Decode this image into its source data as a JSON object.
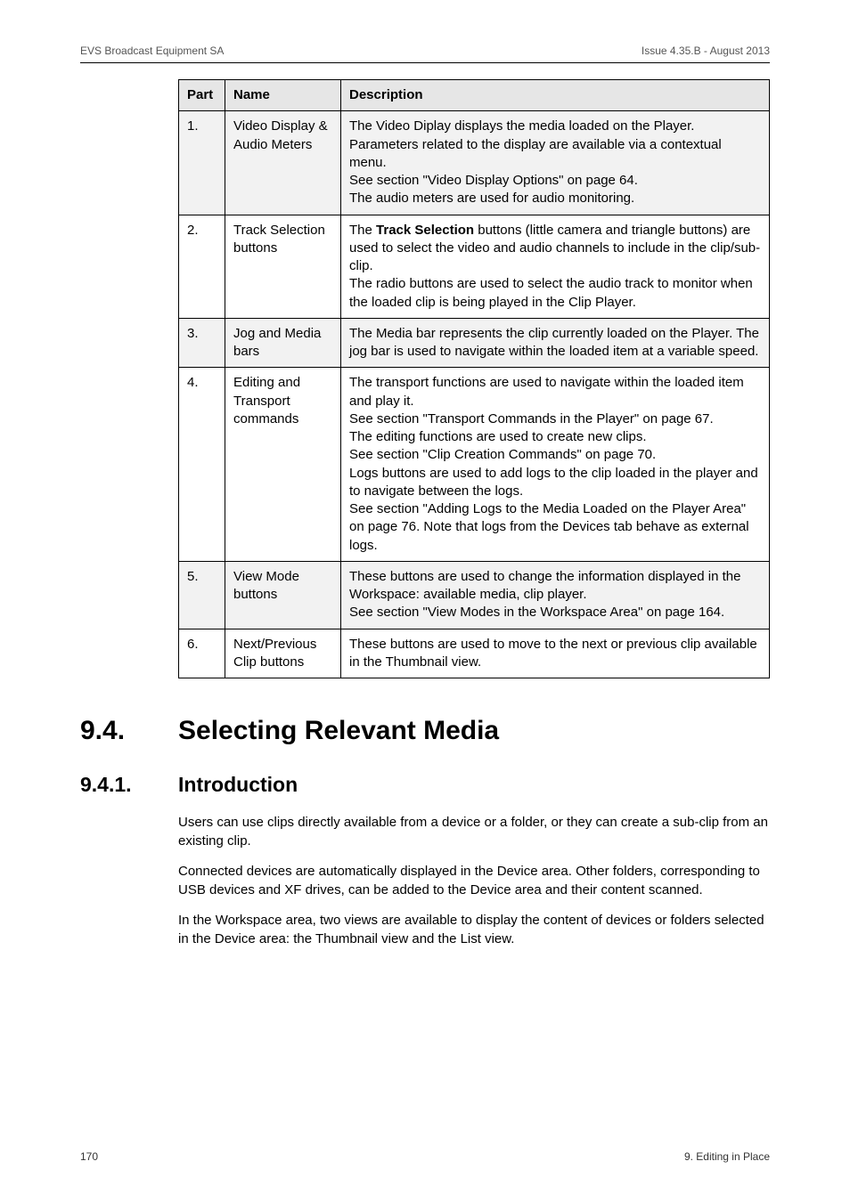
{
  "header": {
    "left": "EVS Broadcast Equipment SA",
    "right": "Issue 4.35.B - August 2013"
  },
  "table": {
    "head": {
      "part": "Part",
      "name": "Name",
      "description": "Description"
    },
    "rows": [
      {
        "part": "1.",
        "name": "Video Display & Audio Meters",
        "desc": "The Video Diplay displays the media loaded on the Player. Parameters related to the display are available via a contextual menu.\nSee section \"Video Display Options\" on page 64.\nThe audio meters are used for audio monitoring."
      },
      {
        "part": "2.",
        "name": "Track Selection buttons",
        "desc_pre": "The ",
        "desc_bold": "Track Selection",
        "desc_post": " buttons (little camera and triangle buttons) are used to select the video and audio channels to include in the clip/sub-clip.\nThe radio buttons are used to select the audio track to monitor when the loaded clip is being played in the Clip Player."
      },
      {
        "part": "3.",
        "name": "Jog and Media bars",
        "desc": "The Media bar represents the clip currently loaded on the Player. The jog bar is used to navigate within the loaded item at a variable speed."
      },
      {
        "part": "4.",
        "name": "Editing and Transport commands",
        "desc": "The transport functions are used to navigate within the loaded item and play it.\nSee section \"Transport Commands in the Player\" on page 67.\nThe editing functions are used to create new clips.\nSee section \"Clip Creation Commands\" on page 70.\nLogs buttons are used to add logs to the clip loaded in the player and to navigate between the logs.\nSee section \"Adding Logs to the Media Loaded on the Player Area\" on page 76. Note that logs from the Devices tab behave as external logs."
      },
      {
        "part": "5.",
        "name": "View Mode buttons",
        "desc": "These buttons are used to change the information displayed in the Workspace: available media, clip player.\nSee section \"View Modes in the Workspace Area\" on page 164."
      },
      {
        "part": "6.",
        "name": "Next/Previous Clip buttons",
        "desc": "These buttons are used to move to the next or previous clip available in the Thumbnail view."
      }
    ]
  },
  "h2": {
    "num": "9.4.",
    "title": "Selecting Relevant Media"
  },
  "h3": {
    "num": "9.4.1.",
    "title": "Introduction"
  },
  "paras": {
    "p1": "Users can use clips directly available from a device or a folder, or they can create a sub-clip from an existing clip.",
    "p2": "Connected devices are automatically displayed in the Device area. Other folders, corresponding to USB devices and XF drives, can be added to the Device area and their content scanned.",
    "p3": "In the Workspace area, two views are available to display the content of devices or folders selected in the Device area: the Thumbnail view and the List view."
  },
  "footer": {
    "left": "170",
    "right": "9. Editing in Place"
  }
}
